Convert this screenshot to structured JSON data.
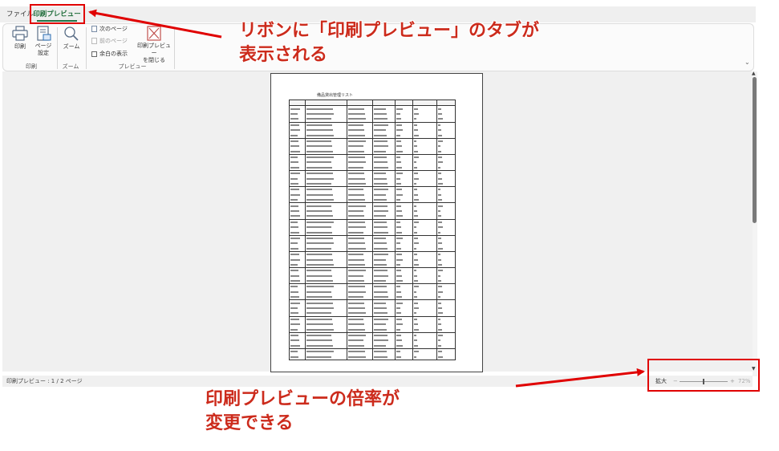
{
  "tabs": [
    {
      "label": "ファイル",
      "active": false
    },
    {
      "label": "印刷プレビュー",
      "active": true
    }
  ],
  "ribbon": {
    "print_label": "印刷",
    "page_setup_label": "ページ\n設定",
    "zoom_label": "ズーム",
    "next_page_label": "次のページ",
    "prev_page_label": "前のページ",
    "show_margins_label": "余白の表示",
    "close_preview_label": "印刷プレビュー\nを閉じる",
    "group_print": "印刷",
    "group_zoom": "ズーム",
    "group_preview": "プレビュー"
  },
  "document": {
    "title": "備品貸出管理リスト"
  },
  "status": {
    "page_text": "印刷プレビュー : 1 / 2 ページ",
    "zoom_label": "拡大",
    "zoom_minus": "−",
    "zoom_plus": "+",
    "zoom_value": "72%",
    "zoom_fraction": 0.5
  },
  "annotations": {
    "ribbon_note": "リボンに「印刷プレビュー」のタブが\n表示される",
    "zoom_note": "印刷プレビューの倍率が\n変更できる",
    "color": "#cc2b1c"
  },
  "colors": {
    "accent": "#217346",
    "highlight": "#e00000"
  },
  "icons": {
    "print": "printer-icon",
    "page_setup": "page-setup-icon",
    "zoom": "magnifier-icon",
    "close": "close-preview-icon"
  }
}
